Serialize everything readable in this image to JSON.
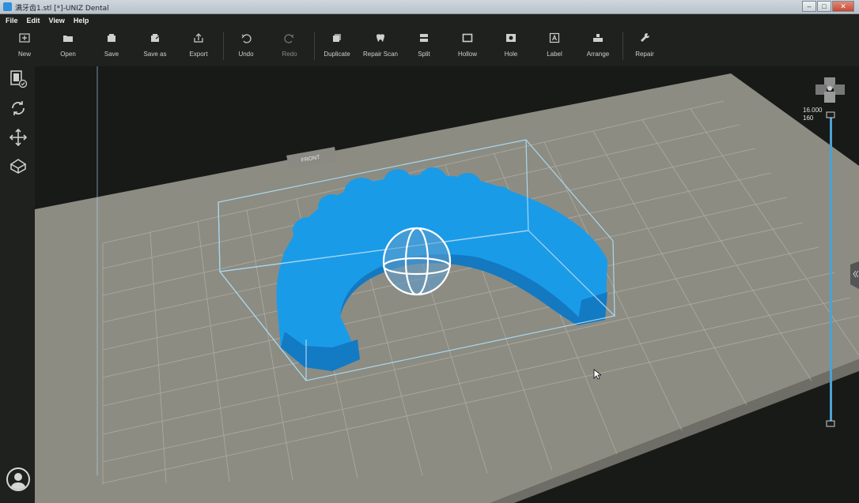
{
  "window": {
    "title": "满牙齿1.stl [*]-UNIZ Dental",
    "min_glyph": "–",
    "max_glyph": "□",
    "close_glyph": "✕"
  },
  "menu": [
    "File",
    "Edit",
    "View",
    "Help"
  ],
  "toolbar": {
    "new": "New",
    "open": "Open",
    "save": "Save",
    "save_as": "Save as",
    "export": "Export",
    "undo": "Undo",
    "redo": "Redo",
    "duplicate": "Duplicate",
    "repair_scan": "Repair Scan",
    "split": "Split",
    "hollow": "Hollow",
    "hole": "Hole",
    "label": "Label",
    "arrange": "Arrange",
    "repair": "Repair"
  },
  "viewport": {
    "front_label": "FRONT",
    "layer_slider": {
      "height_mm": "16.000",
      "layer": "160"
    }
  },
  "colors": {
    "model": "#1a9be8",
    "platform": "#8c8c83",
    "bounding_box": "#a9d8ef",
    "slider": "#4aa3d4"
  }
}
